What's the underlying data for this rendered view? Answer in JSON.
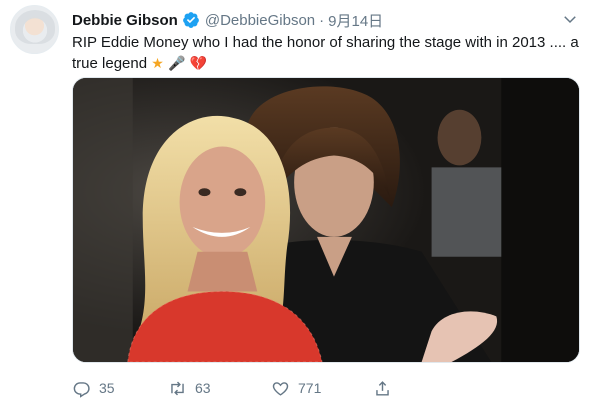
{
  "user": {
    "display_name": "Debbie Gibson",
    "handle": "@DebbieGibson",
    "separator": "·",
    "date": "9月14日",
    "verified": true
  },
  "tweet": {
    "text": "RIP Eddie Money who I had the honor of sharing the stage with in 2013 .... a true legend",
    "emojis": [
      "star",
      "microphone",
      "broken-heart"
    ]
  },
  "media": {
    "type": "photo"
  },
  "actions": {
    "reply_count": "35",
    "retweet_count": "63",
    "like_count": "771"
  },
  "icons": {
    "verified": "verified-badge-icon",
    "caret": "chevron-down-icon",
    "reply": "reply-icon",
    "retweet": "retweet-icon",
    "like": "heart-icon",
    "share": "share-icon"
  },
  "colors": {
    "text_primary": "#14171a",
    "text_secondary": "#657786",
    "verified_blue": "#1da1f2",
    "border": "#e1e8ed"
  }
}
